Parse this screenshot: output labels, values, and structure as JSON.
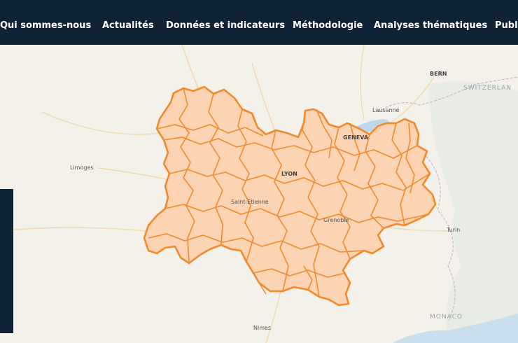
{
  "nav": {
    "items": [
      {
        "label": "Qui sommes-nous"
      },
      {
        "label": "Actualités"
      },
      {
        "label": "Données et indicateurs"
      },
      {
        "label": "Méthodologie"
      },
      {
        "label": "Analyses thématiques"
      },
      {
        "label": "Publi"
      }
    ]
  },
  "map": {
    "region_fill": "#fcd3b3",
    "region_stroke": "#f28a2c",
    "cities": [
      {
        "name": "BERN"
      },
      {
        "name": "Lausanne"
      },
      {
        "name": "GENEVA"
      },
      {
        "name": "Limoges"
      },
      {
        "name": "LYON"
      },
      {
        "name": "Saint-Étienne"
      },
      {
        "name": "Grenoble"
      },
      {
        "name": "Turin"
      },
      {
        "name": "Nimes"
      }
    ],
    "countries": [
      {
        "name": "SWITZERLAN"
      },
      {
        "name": "MONACO"
      }
    ]
  },
  "colors": {
    "nav_bg": "#0f2236",
    "map_bg": "#f4f1ea"
  }
}
